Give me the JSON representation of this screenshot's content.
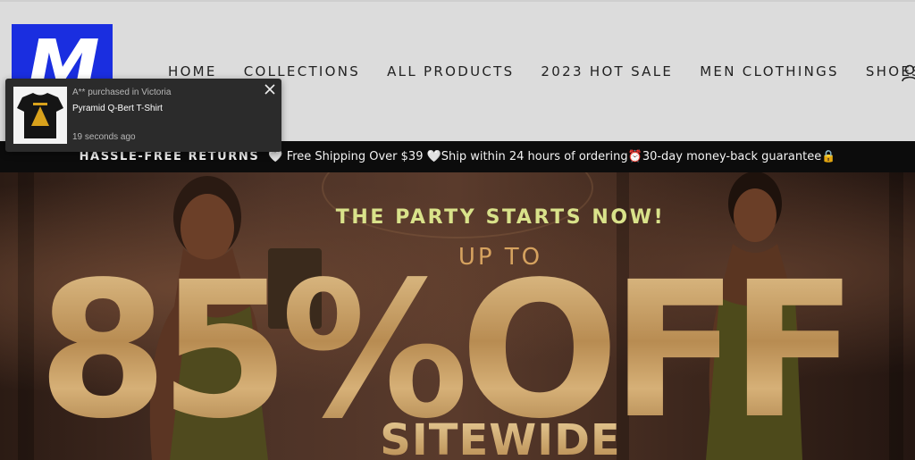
{
  "brand": {
    "logo_letter": "M",
    "logo_color": "#1a2ee0"
  },
  "nav": {
    "items": [
      "HOME",
      "COLLECTIONS",
      "ALL PRODUCTS",
      "2023 HOT SALE",
      "MEN CLOTHINGS",
      "SHOES"
    ],
    "account_icon": "user-icon"
  },
  "announcement": {
    "strong": "HASSLE-FREE RETURNS",
    "rest": "🤍 Free Shipping Over $39 🤍Ship within 24 hours of ordering⏰30-day money-back guarantee🔒"
  },
  "hero": {
    "tagline": "THE PARTY STARTS NOW!",
    "up_to": "UP TO",
    "big_text": "85%OFF",
    "sub_text": "SITEWIDE",
    "accent": "#d6a25f"
  },
  "toast": {
    "meta": "A** purchased in Victoria",
    "product": "Pyramid Q-Bert T-Shirt",
    "time": "19 seconds ago",
    "close_icon": "close-icon"
  }
}
